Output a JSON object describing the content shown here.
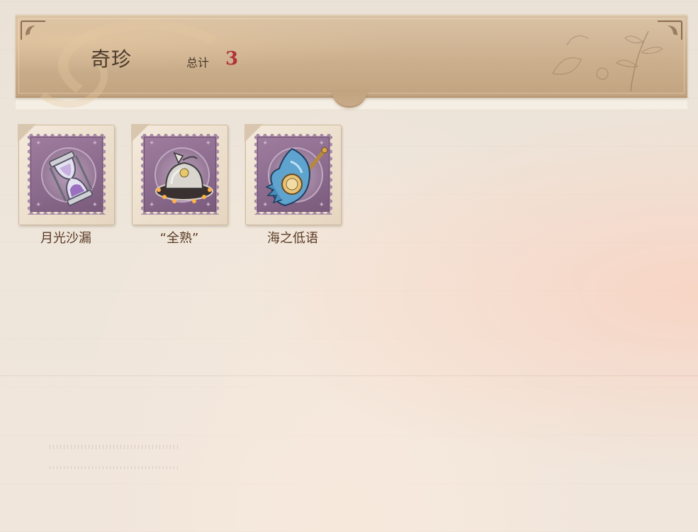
{
  "header": {
    "title": "奇珍",
    "total_label": "总计",
    "total_value": "3"
  },
  "items": [
    {
      "name": "月光沙漏",
      "icon": "hourglass-icon"
    },
    {
      "name": "“全熟”",
      "icon": "cloche-platter-icon"
    },
    {
      "name": "海之低语",
      "icon": "seashell-scepter-icon"
    }
  ],
  "colors": {
    "banner": "#ccb08e",
    "title_text": "#4a3a2c",
    "total_value": "#b0333a",
    "stamp_purple": "#8a6a8c",
    "item_label": "#5a3a26"
  }
}
